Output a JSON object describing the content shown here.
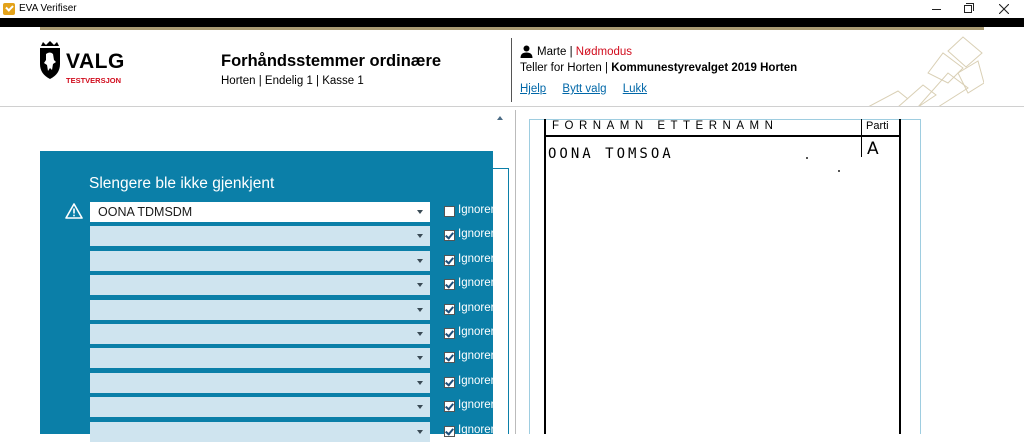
{
  "window": {
    "title": "EVA Verifiser"
  },
  "header": {
    "logo_text": "VALG",
    "logo_subtext": "TESTVERSJON",
    "title": "Forhåndsstemmer ordinære",
    "subtitle": "Horten | Endelig 1 | Kasse 1",
    "user_name": "Marte |",
    "mode": "Nødmodus",
    "teller_role": "Teller for Horten  |",
    "election": "Kommunestyrevalget 2019 Horten",
    "links": {
      "help": "Hjelp",
      "switch_election": "Bytt valg",
      "close": "Lukk"
    }
  },
  "panel": {
    "title": "Slengere ble ikke gjenkjent",
    "ignore_label": "Ignorer",
    "rows": [
      {
        "value": "OONA TDMSDM",
        "ignored": false,
        "warning": true
      },
      {
        "value": "",
        "ignored": true,
        "warning": false
      },
      {
        "value": "",
        "ignored": true,
        "warning": false
      },
      {
        "value": "",
        "ignored": true,
        "warning": false
      },
      {
        "value": "",
        "ignored": true,
        "warning": false
      },
      {
        "value": "",
        "ignored": true,
        "warning": false
      },
      {
        "value": "",
        "ignored": true,
        "warning": false
      },
      {
        "value": "",
        "ignored": true,
        "warning": false
      },
      {
        "value": "",
        "ignored": true,
        "warning": false
      },
      {
        "value": "",
        "ignored": true,
        "warning": false
      }
    ]
  },
  "ballot": {
    "header_name": "FORNAMN ETTERNAMN",
    "header_party": "Parti",
    "written_name": "OONA TOMSOA",
    "written_party": "A"
  },
  "colors": {
    "panel": "#0b7fa8",
    "row_bg": "#cfe4ef",
    "warning_text": "#d10b1c",
    "link": "#0067a8",
    "gold": "#a99b73"
  }
}
